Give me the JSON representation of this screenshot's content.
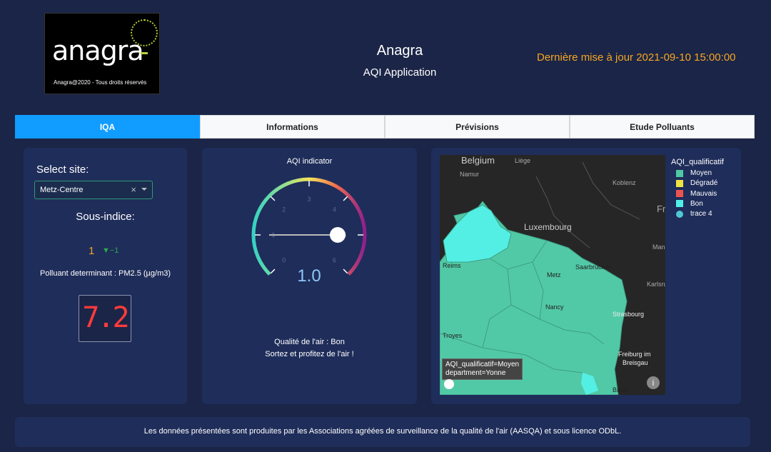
{
  "header": {
    "logo_text": "anagra",
    "logo_copyright": "Anagra@2020 -  Tous droits réservés",
    "title": "Anagra",
    "subtitle": "AQI Application",
    "last_update": "Dernière mise à jour 2021-09-10 15:00:00"
  },
  "tabs": [
    {
      "label": "IQA",
      "active": true
    },
    {
      "label": "Informations",
      "active": false
    },
    {
      "label": "Prévisions",
      "active": false
    },
    {
      "label": "Etude Polluants",
      "active": false
    }
  ],
  "site_panel": {
    "select_label": "Select site:",
    "selected_site": "Metz-Centre",
    "clear_glyph": "×",
    "sous_indice_label": "Sous-indice:",
    "sous_indice_value": "1",
    "sous_indice_delta": "▼−1",
    "polluant_text": "Polluant determinant : PM2.5 (µg/m3)",
    "led_value": "7.2"
  },
  "gauge": {
    "title": "AQI indicator",
    "value": 1.0,
    "value_text": "1.0",
    "min": 0,
    "max": 6,
    "ticks": [
      "0",
      "1",
      "2",
      "3",
      "4",
      "5",
      "6"
    ]
  },
  "quality": {
    "qualite_text": "Qualité de l'air : Bon",
    "conseil_text": "Sortez et profitez de l'air !"
  },
  "map": {
    "labels": [
      "Belgium",
      "Liège",
      "Namur",
      "Koblenz",
      "Luxembourg",
      "Mannh",
      "Fr",
      "Reims",
      "Metz",
      "Saarbrücken",
      "Karlsru",
      "Nancy",
      "Strasbourg",
      "Troyes",
      "Freiburg im",
      "Breisgau",
      "Basel"
    ],
    "tooltip_line1": "AQI_qualificatif=Moyen",
    "tooltip_line2": "department=Yonne"
  },
  "legend": {
    "title": "AQI_qualificatif",
    "items": [
      {
        "label": "Moyen",
        "color": "#50c8a4",
        "shape": "square"
      },
      {
        "label": "Dégradé",
        "color": "#f0e442",
        "shape": "square"
      },
      {
        "label": "Mauvais",
        "color": "#ef5350",
        "shape": "square"
      },
      {
        "label": "Bon",
        "color": "#50f0e6",
        "shape": "square"
      },
      {
        "label": "trace 4",
        "color": "#50c8d4",
        "shape": "circle"
      }
    ]
  },
  "footer": {
    "text": "Les données présentées sont produites par les Associations agréées de surveillance de la qualité de l'air (AASQA) et sous licence ODbL."
  },
  "colors": {
    "background": "#1b2547",
    "panel": "#1f2d5a",
    "accent_tab": "#119dff",
    "orange": "#f5a623"
  }
}
